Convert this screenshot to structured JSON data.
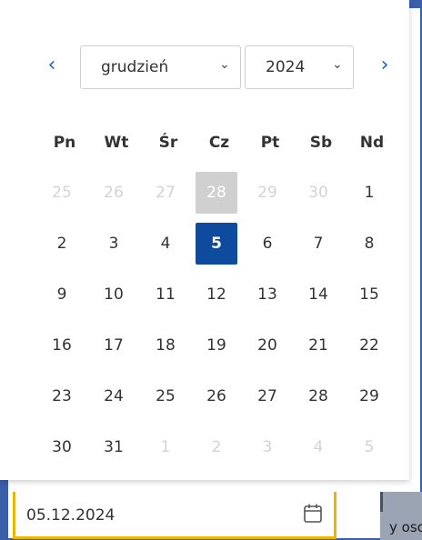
{
  "datepicker": {
    "prev_glyph": "‹",
    "next_glyph": "›",
    "month_select": {
      "value": "grudzień"
    },
    "year_select": {
      "value": "2024"
    },
    "chevron": "⌄",
    "weekdays": [
      "Pn",
      "Wt",
      "Śr",
      "Cz",
      "Pt",
      "Sb",
      "Nd"
    ],
    "weeks": [
      [
        "25",
        "26",
        "27",
        "28",
        "29",
        "30",
        "1"
      ],
      [
        "2",
        "3",
        "4",
        "5",
        "6",
        "7",
        "8"
      ],
      [
        "9",
        "10",
        "11",
        "12",
        "13",
        "14",
        "15"
      ],
      [
        "16",
        "17",
        "18",
        "19",
        "20",
        "21",
        "22"
      ],
      [
        "23",
        "24",
        "25",
        "26",
        "27",
        "28",
        "29"
      ],
      [
        "30",
        "31",
        "1",
        "2",
        "3",
        "4",
        "5"
      ]
    ],
    "muted": [
      [
        0,
        0
      ],
      [
        0,
        1
      ],
      [
        0,
        2
      ],
      [
        0,
        4
      ],
      [
        0,
        5
      ],
      [
        5,
        2
      ],
      [
        5,
        3
      ],
      [
        5,
        4
      ],
      [
        5,
        5
      ],
      [
        5,
        6
      ]
    ],
    "today": [
      0,
      3
    ],
    "selected": [
      1,
      3
    ],
    "colors": {
      "accent": "#0e4a9e",
      "nav": "#1f5fae",
      "focus_border": "#e8b800",
      "frame": "#3b5ea8"
    }
  },
  "date_input": {
    "value": "05.12.2024",
    "icon": "calendar-icon"
  },
  "background_fragment": {
    "text": "y osc"
  }
}
